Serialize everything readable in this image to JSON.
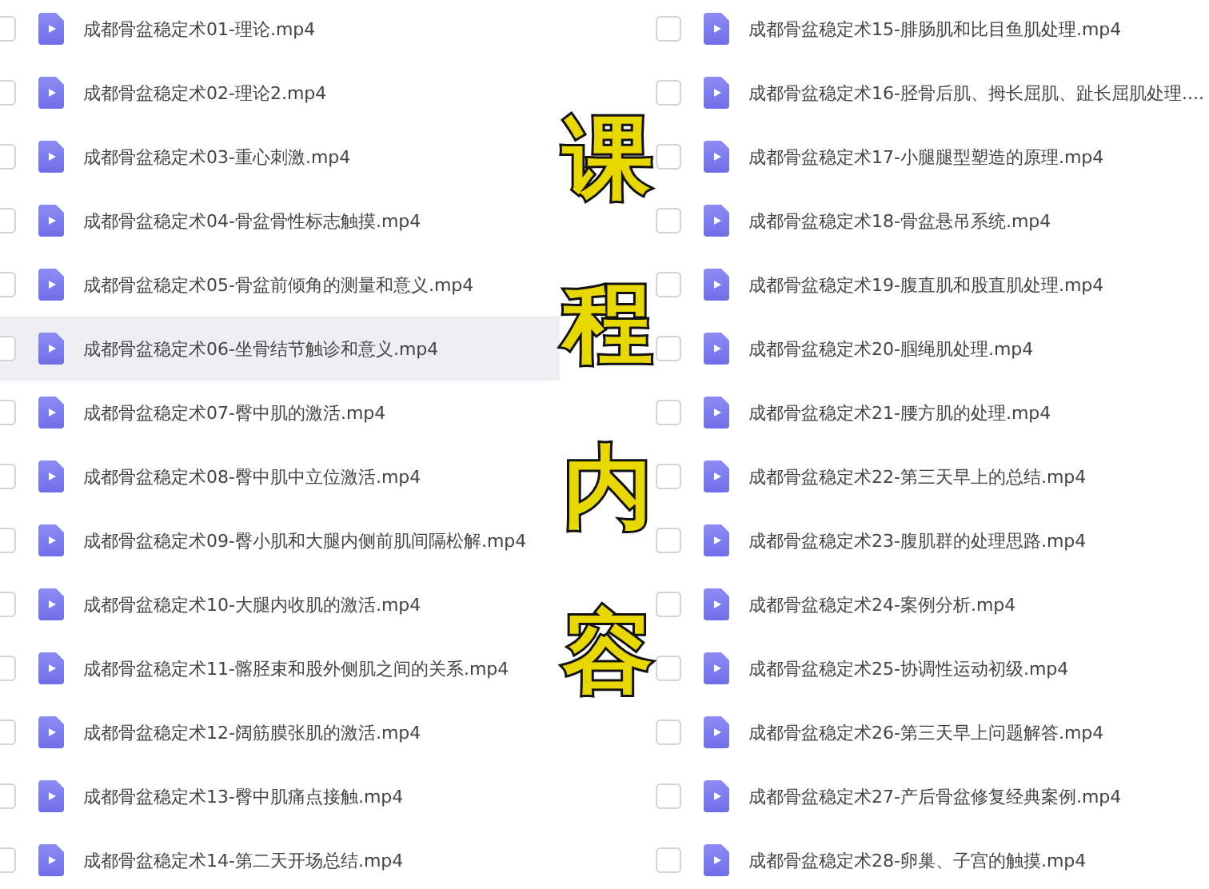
{
  "columns": [
    {
      "files": [
        {
          "name": "成都骨盆稳定术01-理论.mp4",
          "checked": false,
          "highlighted": false
        },
        {
          "name": "成都骨盆稳定术02-理论2.mp4",
          "checked": false,
          "highlighted": false
        },
        {
          "name": "成都骨盆稳定术03-重心刺激.mp4",
          "checked": false,
          "highlighted": false
        },
        {
          "name": "成都骨盆稳定术04-骨盆骨性标志触摸.mp4",
          "checked": false,
          "highlighted": false
        },
        {
          "name": "成都骨盆稳定术05-骨盆前倾角的测量和意义.mp4",
          "checked": false,
          "highlighted": false
        },
        {
          "name": "成都骨盆稳定术06-坐骨结节触诊和意义.mp4",
          "checked": false,
          "highlighted": true
        },
        {
          "name": "成都骨盆稳定术07-臀中肌的激活.mp4",
          "checked": false,
          "highlighted": false
        },
        {
          "name": "成都骨盆稳定术08-臀中肌中立位激活.mp4",
          "checked": false,
          "highlighted": false
        },
        {
          "name": "成都骨盆稳定术09-臀小肌和大腿内侧前肌间隔松解.mp4",
          "checked": false,
          "highlighted": false
        },
        {
          "name": "成都骨盆稳定术10-大腿内收肌的激活.mp4",
          "checked": false,
          "highlighted": false
        },
        {
          "name": "成都骨盆稳定术11-髂胫束和股外侧肌之间的关系.mp4",
          "checked": false,
          "highlighted": false
        },
        {
          "name": "成都骨盆稳定术12-阔筋膜张肌的激活.mp4",
          "checked": false,
          "highlighted": false
        },
        {
          "name": "成都骨盆稳定术13-臀中肌痛点接触.mp4",
          "checked": false,
          "highlighted": false
        },
        {
          "name": "成都骨盆稳定术14-第二天开场总结.mp4",
          "checked": false,
          "highlighted": false
        }
      ]
    },
    {
      "files": [
        {
          "name": "成都骨盆稳定术15-腓肠肌和比目鱼肌处理.mp4",
          "checked": false,
          "highlighted": false
        },
        {
          "name": "成都骨盆稳定术16-胫骨后肌、拇长屈肌、趾长屈肌处理....",
          "checked": false,
          "highlighted": false
        },
        {
          "name": "成都骨盆稳定术17-小腿腿型塑造的原理.mp4",
          "checked": false,
          "highlighted": false
        },
        {
          "name": "成都骨盆稳定术18-骨盆悬吊系统.mp4",
          "checked": false,
          "highlighted": false
        },
        {
          "name": "成都骨盆稳定术19-腹直肌和股直肌处理.mp4",
          "checked": false,
          "highlighted": false
        },
        {
          "name": "成都骨盆稳定术20-腘绳肌处理.mp4",
          "checked": false,
          "highlighted": false
        },
        {
          "name": "成都骨盆稳定术21-腰方肌的处理.mp4",
          "checked": false,
          "highlighted": false
        },
        {
          "name": "成都骨盆稳定术22-第三天早上的总结.mp4",
          "checked": false,
          "highlighted": false
        },
        {
          "name": "成都骨盆稳定术23-腹肌群的处理思路.mp4",
          "checked": false,
          "highlighted": false
        },
        {
          "name": "成都骨盆稳定术24-案例分析.mp4",
          "checked": false,
          "highlighted": false
        },
        {
          "name": "成都骨盆稳定术25-协调性运动初级.mp4",
          "checked": false,
          "highlighted": false
        },
        {
          "name": "成都骨盆稳定术26-第三天早上问题解答.mp4",
          "checked": false,
          "highlighted": false
        },
        {
          "name": "成都骨盆稳定术27-产后骨盆修复经典案例.mp4",
          "checked": false,
          "highlighted": false
        },
        {
          "name": "成都骨盆稳定术28-卵巢、子宫的触摸.mp4",
          "checked": false,
          "highlighted": false
        }
      ]
    }
  ],
  "overlay_title": "课程内容"
}
